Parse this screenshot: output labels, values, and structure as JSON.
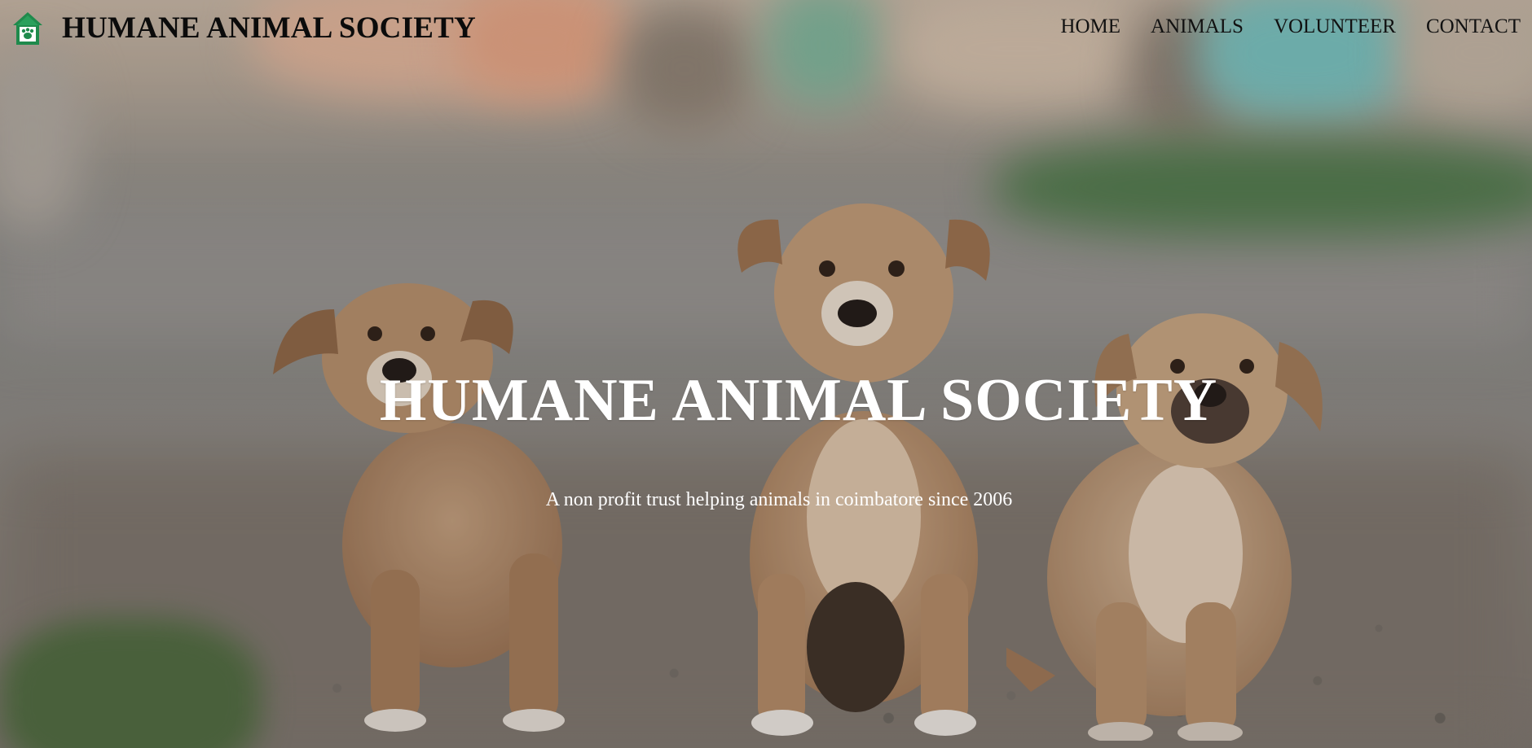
{
  "brand": {
    "name": "HUMANE ANIMAL SOCIETY",
    "logo_icon": "house-paw-logo-icon",
    "logo_color": "#1f8a4c"
  },
  "nav": {
    "items": [
      {
        "label": "HOME"
      },
      {
        "label": "ANIMALS"
      },
      {
        "label": "VOLUNTEER"
      },
      {
        "label": "CONTACT"
      }
    ]
  },
  "hero": {
    "title": "HUMANE ANIMAL SOCIETY",
    "subtitle": "A non profit trust helping animals in coimbatore since 2006",
    "background": "three puppies sitting on gravel street photo",
    "text_color": "#ffffff"
  }
}
